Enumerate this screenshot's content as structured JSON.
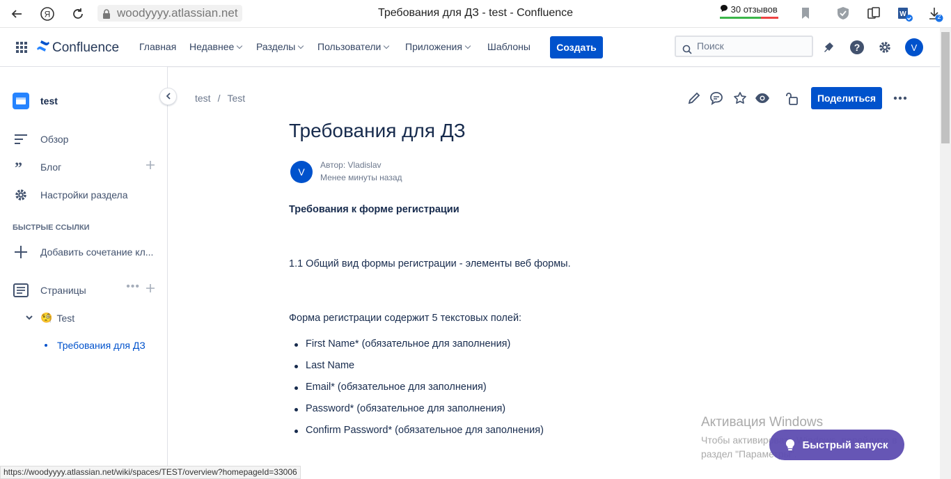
{
  "browser": {
    "url": "woodyyyy.atlassian.net",
    "tab_title": "Требования для ДЗ - test - Confluence",
    "reviews": "30 отзывов",
    "downloads_badge": "2",
    "status_url": "https://woodyyyy.atlassian.net/wiki/spaces/TEST/overview?homepageId=33006"
  },
  "topnav": {
    "logo": "Confluence",
    "items": [
      {
        "label": "Главная",
        "dropdown": false
      },
      {
        "label": "Недавнее",
        "dropdown": true
      },
      {
        "label": "Разделы",
        "dropdown": true
      },
      {
        "label": "Пользователи",
        "dropdown": true
      },
      {
        "label": "Приложения",
        "dropdown": true
      },
      {
        "label": "Шаблоны",
        "dropdown": false
      }
    ],
    "create_label": "Создать",
    "search_placeholder": "Поиск",
    "avatar_initial": "V"
  },
  "sidebar": {
    "space_name": "test",
    "items": [
      {
        "label": "Обзор",
        "icon": "overview-icon"
      },
      {
        "label": "Блог",
        "icon": "quote-icon"
      },
      {
        "label": "Настройки раздела",
        "icon": "gear-icon"
      }
    ],
    "quick_links_heading": "БЫСТРЫЕ ССЫЛКИ",
    "add_shortcut": "Добавить сочетание кл...",
    "pages_label": "Страницы",
    "tree": [
      {
        "label": "Test",
        "emoji": "🧐",
        "expanded": true
      },
      {
        "label": "Требования для ДЗ",
        "active": true
      }
    ]
  },
  "content": {
    "breadcrumb": [
      "test",
      "Test"
    ],
    "share_label": "Поделиться",
    "title": "Требования для ДЗ",
    "author_initial": "V",
    "author_line": "Автор: Vladislav",
    "time_line": "Менее минуты назад",
    "heading": "Требования к форме регистрации",
    "p1": "1.1 Общий вид формы регистрации - элементы веб формы.",
    "p2": "Форма регистрации содержит 5 текстовых полей:",
    "bullets": [
      "First Name* (обязательное для заполнения)",
      "Last Name",
      "Email* (обязательное для заполнения)",
      "Password* (обязательное для заполнения)",
      "Confirm Password* (обязательное для заполнения)"
    ]
  },
  "overlay": {
    "activation_title": "Активация Windows",
    "activation_line1": "Чтобы активировать Windows, перейдите в",
    "activation_line2": "раздел \"Параметры\".",
    "quick_start": "Быстрый запуск"
  },
  "colors": {
    "brand": "#0052cc",
    "quick_start": "#5e4db2",
    "text": "#172b4d"
  }
}
